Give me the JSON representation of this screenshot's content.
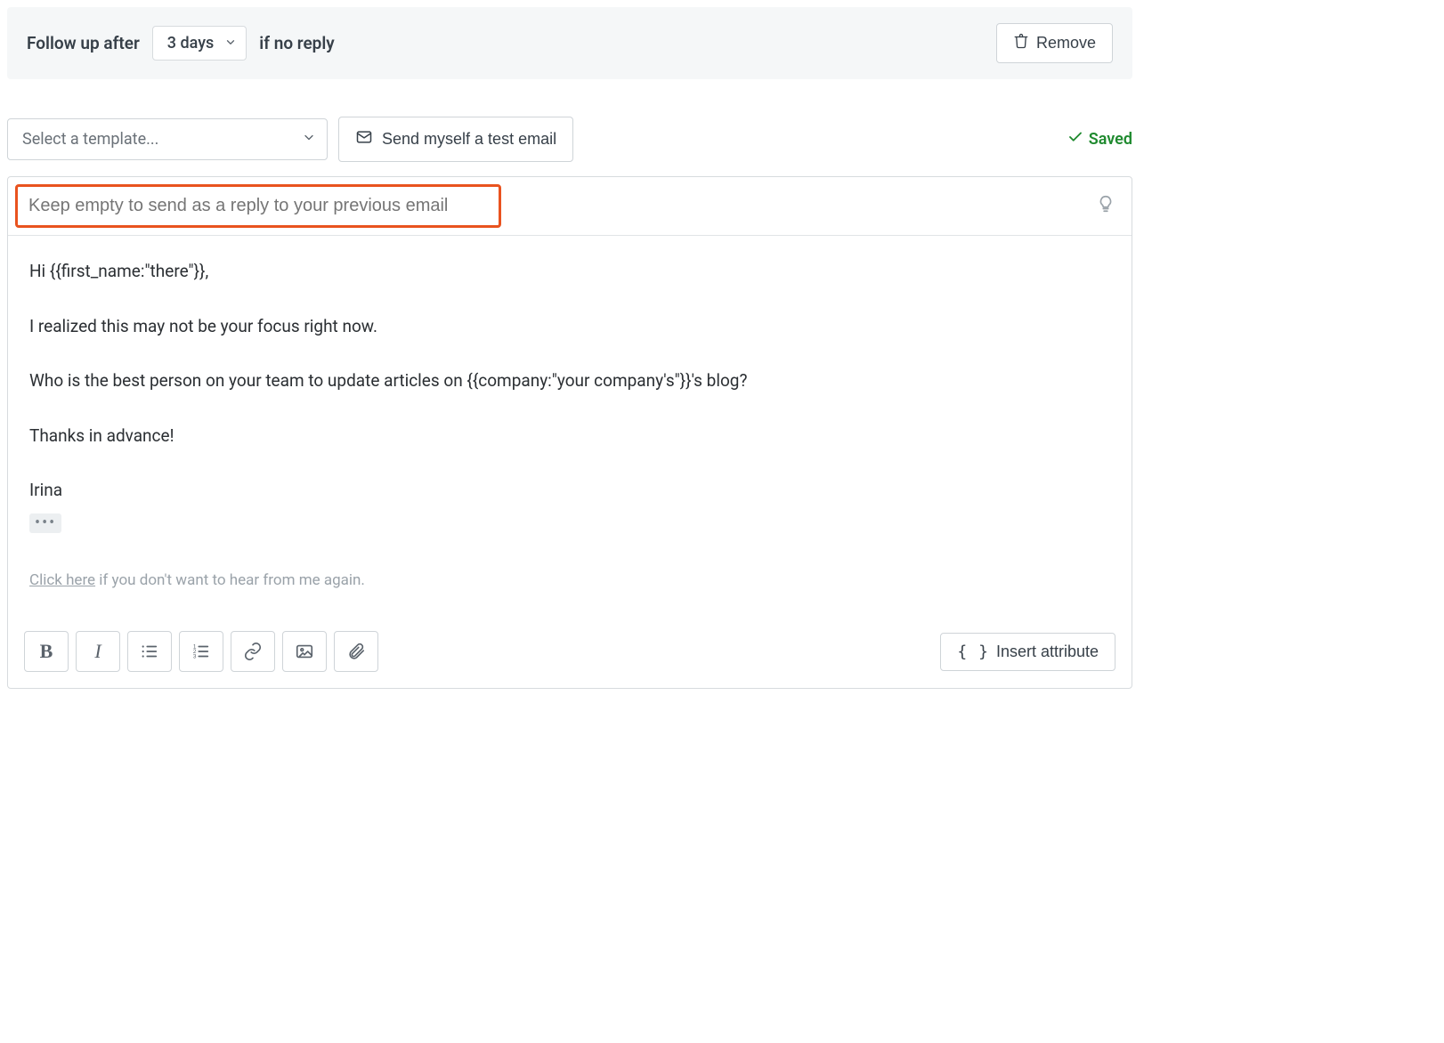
{
  "header": {
    "prefix": "Follow up after",
    "delay_value": "3 days",
    "suffix": "if no reply",
    "remove_label": "Remove"
  },
  "controls": {
    "template_placeholder": "Select a template...",
    "test_email_label": "Send myself a test email",
    "saved_label": "Saved"
  },
  "subject": {
    "placeholder": "Keep empty to send as a reply to your previous email",
    "value": ""
  },
  "body": {
    "lines": [
      "Hi {{first_name:\"there\"}},",
      "I realized this may not be your focus right now.",
      "Who is the best person on your team to update articles on {{company:\"your company's\"}}'s blog?",
      "Thanks in advance!",
      "Irina"
    ],
    "unsubscribe_link": "Click here",
    "unsubscribe_text": " if you don't want to hear from me again."
  },
  "toolbar": {
    "insert_attribute_label": "Insert attribute"
  },
  "icons": {
    "trash": "trash-icon",
    "chevron_down": "chevron-down-icon",
    "envelope": "envelope-icon",
    "check": "check-icon",
    "lightbulb": "lightbulb-icon"
  },
  "colors": {
    "highlight_border": "#e9531f",
    "saved_green": "#1f8a2f"
  }
}
